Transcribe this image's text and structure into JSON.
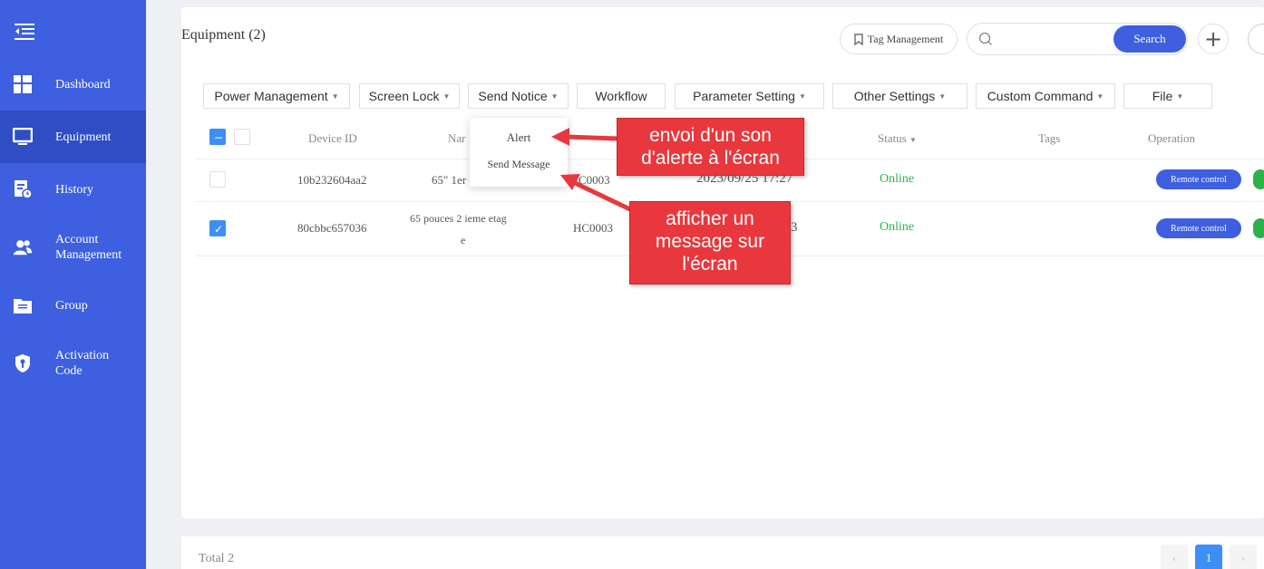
{
  "sidebar": {
    "items": [
      {
        "label": "Dashboard"
      },
      {
        "label": "Equipment"
      },
      {
        "label": "History"
      },
      {
        "label": "Account Management"
      },
      {
        "label": "Group"
      },
      {
        "label": "Activation Code"
      }
    ],
    "active_index": 1,
    "color": "#3d5fe0"
  },
  "header": {
    "title": "Equipment (2)",
    "tag_management": "Tag Management",
    "search_placeholder": "",
    "search_label": "Search",
    "add_label": "+"
  },
  "toolbar": {
    "power": "Power Management",
    "screen_lock": "Screen Lock",
    "send_notice": "Send Notice",
    "workflow": "Workflow",
    "parameter": "Parameter Setting",
    "other": "Other Settings",
    "custom": "Custom Command",
    "file": "File"
  },
  "table": {
    "headers": {
      "device_id": "Device ID",
      "name": "Nar",
      "status": "Status",
      "tags": "Tags",
      "operation": "Operation"
    },
    "rows": [
      {
        "device_id": "10b232604aa2",
        "name": "65\" 1er",
        "group": "C0003",
        "time": "2023/09/25 17:27",
        "status": "Online",
        "action": "Remote control",
        "checked": false
      },
      {
        "device_id": "80cbbc657036",
        "name": "65 pouces 2 ieme etag",
        "name2": "e",
        "group": "HC0003",
        "time": "3",
        "status": "Online",
        "action": "Remote control",
        "checked": true
      }
    ]
  },
  "dropdown": {
    "alert": "Alert",
    "send_message": "Send Message"
  },
  "annotations": {
    "alert_note": "envoi d'un son d'alerte à l'écran",
    "message_note": "afficher un message sur l'écran",
    "color": "#e8383d"
  },
  "footer": {
    "total": "Total 2",
    "page": "1"
  }
}
